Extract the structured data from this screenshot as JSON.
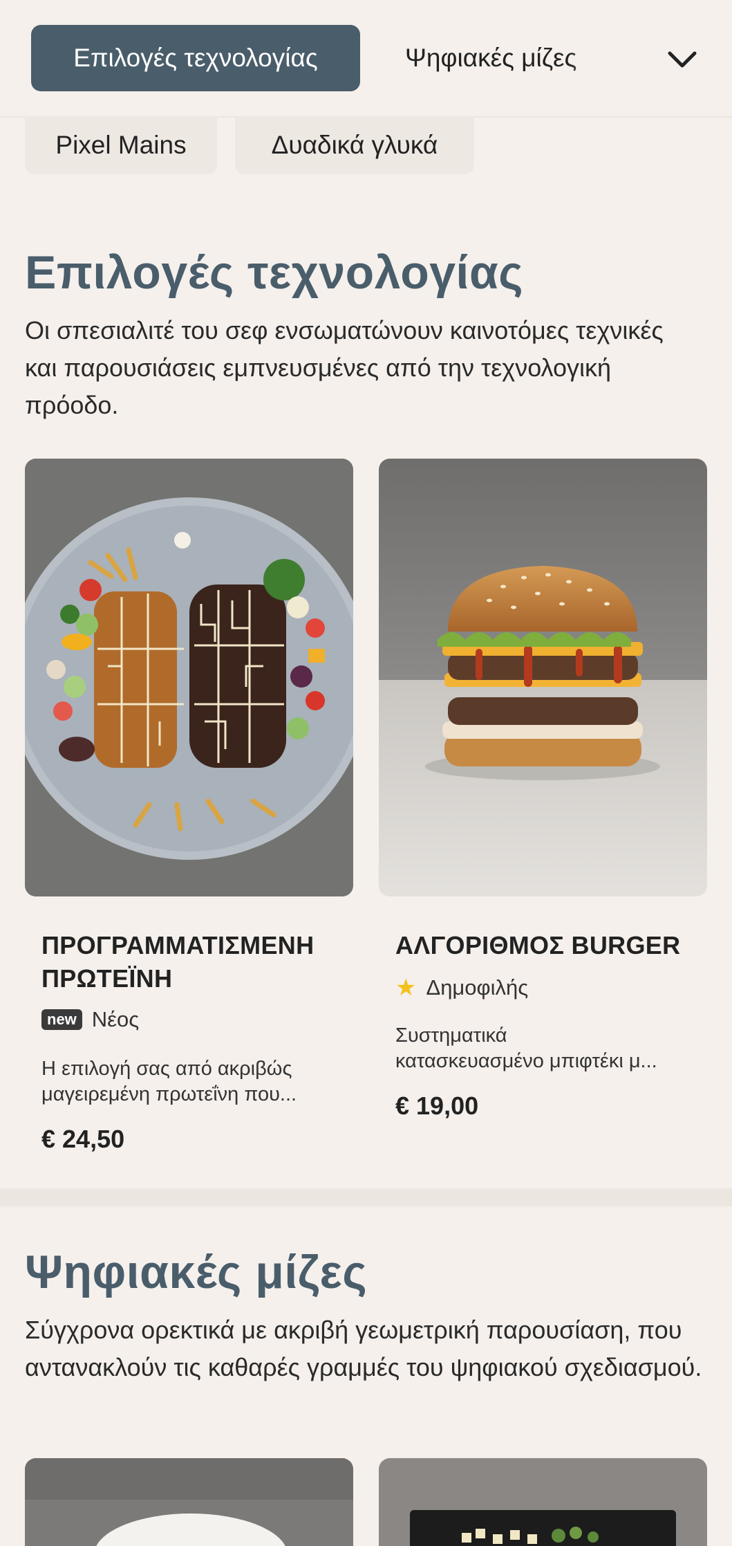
{
  "nav": {
    "active_tab": "Επιλογές τεχνολογίας",
    "next_tab": "Ψηφιακές μίζες",
    "more_tabs": [
      "Pixel Mains",
      "Δυαδικά γλυκά"
    ]
  },
  "sections": [
    {
      "title": "Επιλογές τεχνολογίας",
      "description": "Οι σπεσιαλιτέ του σεφ ενσωματώνουν καινοτόμες τεχνικές και παρουσιάσεις εμπνευσμένες από την τεχνολογική πρόοδο.",
      "items": [
        {
          "name": "ΠΡΟΓΡΑΜΜΑΤΙΣΜΕΝΗ ΠΡΩΤΕΪΝΗ",
          "badge": "new",
          "tag": "Νέος",
          "description_line1": "Η επιλογή σας από ακριβώς",
          "description_line2": "μαγειρεμένη πρωτεΐνη που...",
          "price": "€ 24,50"
        },
        {
          "name": "ΑΛΓΟΡΙΘΜΟΣ BURGER",
          "tag": "Δημοφιλής",
          "description_line1": "Συστηματικά",
          "description_line2": "κατασκευασμένο μπιφτέκι μ...",
          "price": "€ 19,00"
        }
      ]
    },
    {
      "title": "Ψηφιακές μίζες",
      "description": "Σύγχρονα ορεκτικά με ακριβή γεωμετρική παρουσίαση, που αντανακλούν τις καθαρές γραμμές του ψηφιακού σχεδιασμού."
    }
  ],
  "colors": {
    "background": "#f5f0ec",
    "accent": "#4a5d6b",
    "star": "#f3c01e"
  }
}
